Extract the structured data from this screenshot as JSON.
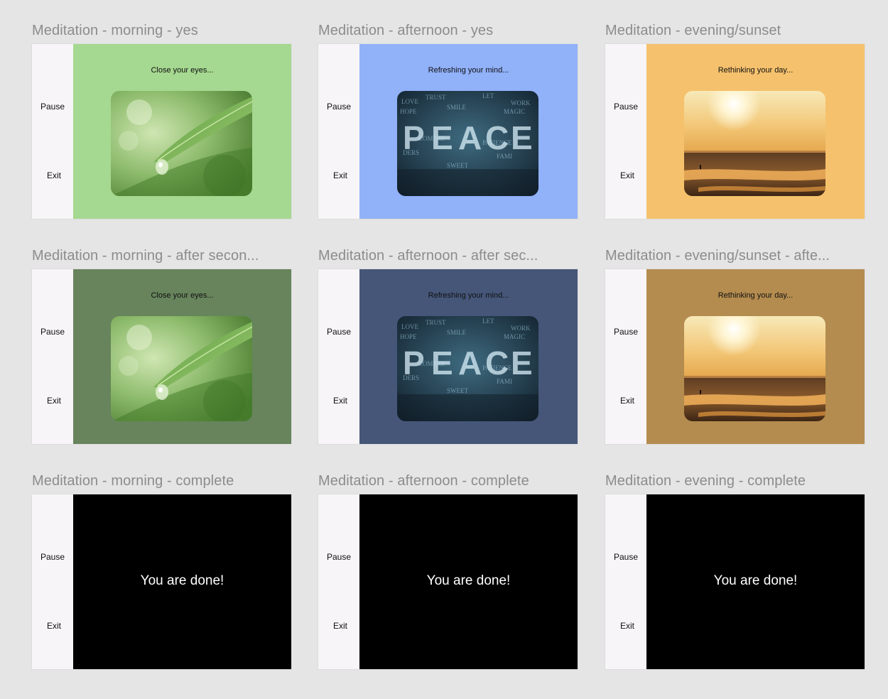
{
  "frames": [
    {
      "title": "Meditation - morning - yes",
      "caption": "Close your eyes...",
      "pause": "Pause",
      "exit": "Exit",
      "bg": "#a5d890",
      "image": "leaf-drop"
    },
    {
      "title": "Meditation - afternoon - yes",
      "caption": "Refreshing your mind...",
      "pause": "Pause",
      "exit": "Exit",
      "bg": "#91b1f9",
      "image": "peace-words"
    },
    {
      "title": "Meditation - evening/sunset",
      "caption": "Rethinking your day...",
      "pause": "Pause",
      "exit": "Exit",
      "bg": "#f5c16d",
      "image": "sunset-beach"
    },
    {
      "title": "Meditation - morning - after secon...",
      "caption": "Close your eyes...",
      "pause": "Pause",
      "exit": "Exit",
      "bg": "#67845c",
      "image": "leaf-drop"
    },
    {
      "title": "Meditation - afternoon - after sec...",
      "caption": "Refreshing your mind...",
      "pause": "Pause",
      "exit": "Exit",
      "bg": "#455679",
      "image": "peace-words"
    },
    {
      "title": "Meditation - evening/sunset - afte...",
      "caption": "Rethinking your day...",
      "pause": "Pause",
      "exit": "Exit",
      "bg": "#b48c4f",
      "image": "sunset-beach"
    },
    {
      "title": "Meditation - morning - complete",
      "message": "You are done!",
      "pause": "Pause",
      "exit": "Exit",
      "bg": "#000000"
    },
    {
      "title": "Meditation - afternoon - complete",
      "message": "You are done!",
      "pause": "Pause",
      "exit": "Exit",
      "bg": "#000000"
    },
    {
      "title": "Meditation - evening - complete",
      "message": "You are done!",
      "pause": "Pause",
      "exit": "Exit",
      "bg": "#000000"
    }
  ]
}
